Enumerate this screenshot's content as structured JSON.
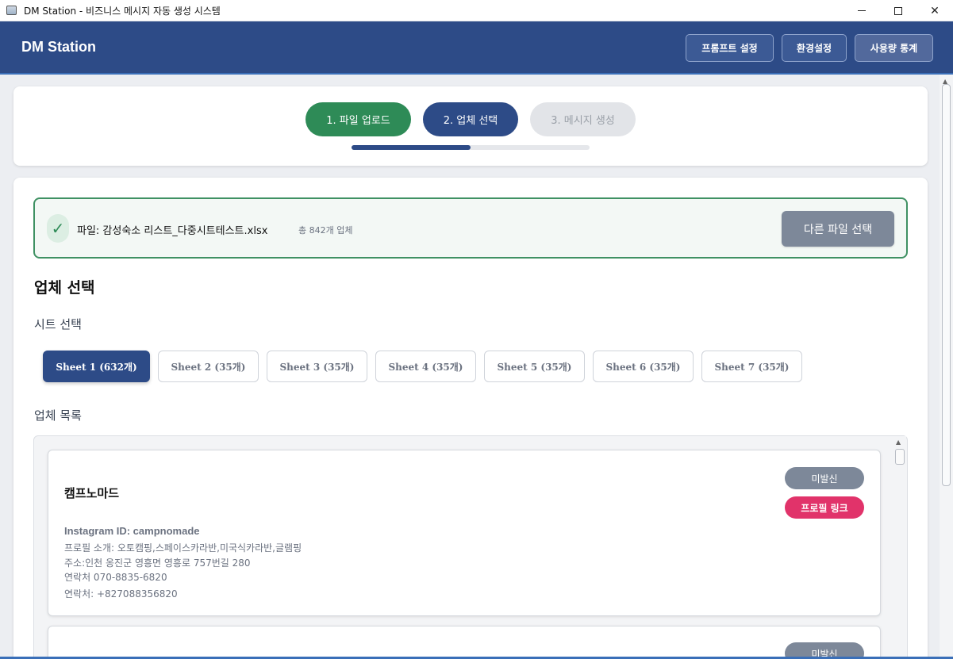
{
  "window": {
    "title": "DM Station - 비즈니스 메시지 자동 생성 시스템"
  },
  "header": {
    "brand": "DM Station",
    "buttons": {
      "prompt": "프롬프트 설정",
      "env": "환경설정",
      "usage": "사용량 통계"
    }
  },
  "steps": {
    "items": [
      "1. 파일 업로드",
      "2. 업체 선택",
      "3. 메시지 생성"
    ],
    "current": 2,
    "progress_fraction": 0.5
  },
  "file": {
    "label": "파일: 감성숙소 리스트_다중시트테스트.xlsx",
    "count": "총 842개 업체",
    "change_button": "다른 파일 선택"
  },
  "section": {
    "title": "업체 선택",
    "sheet_label": "시트 선택",
    "list_label": "업체 목록"
  },
  "sheets": [
    "Sheet 1 (632개)",
    "Sheet 2 (35개)",
    "Sheet 3 (35개)",
    "Sheet 4 (35개)",
    "Sheet 5 (35개)",
    "Sheet 6 (35개)",
    "Sheet 7 (35개)"
  ],
  "companies": [
    {
      "name": "캠프노마드",
      "instagram": "Instagram ID: campnomade",
      "bio": "프로필 소개: 오토캠핑,스페이스카라반,미국식카라반,글램핑",
      "address": "주소:인천 옹진군 영흥면 영흥로 757번길 280",
      "contact1": "연락처 070-8835-6820",
      "contact2": "연락처: +827088356820",
      "status": "미발신",
      "profile_link": "프로필 링크"
    },
    {
      "status": "미발신"
    }
  ],
  "colors": {
    "primary": "#2d4b87",
    "success": "#2e8b57",
    "pink": "#e1336a",
    "muted": "#7d8899"
  },
  "icons": {
    "check": "check-icon",
    "minimize": "minimize-icon",
    "maximize": "maximize-icon",
    "close": "close-icon"
  }
}
